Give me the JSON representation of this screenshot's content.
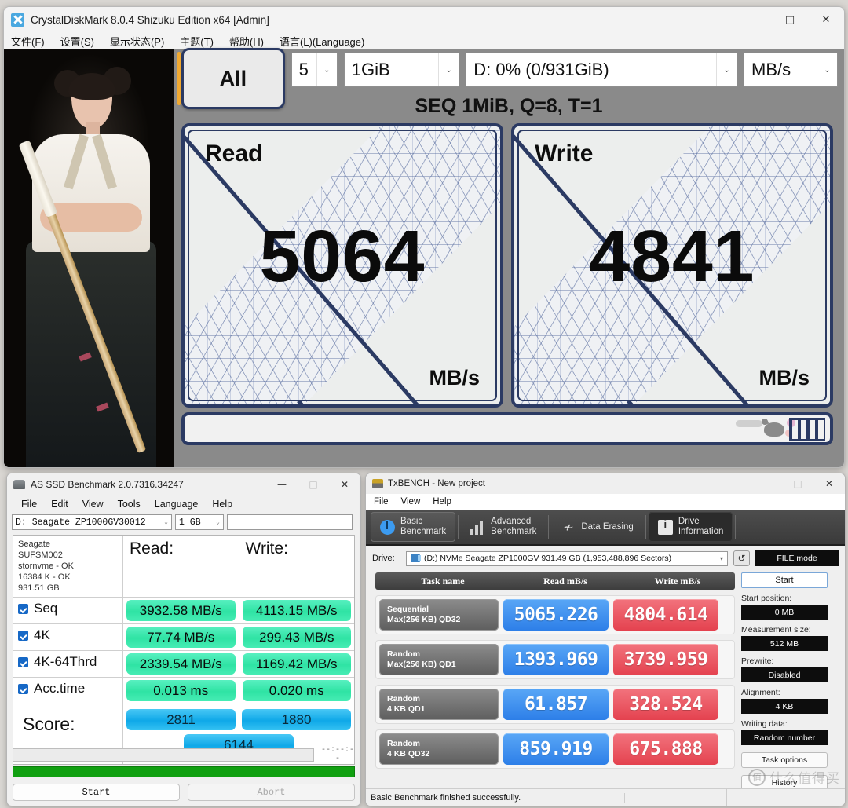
{
  "crystaldiskmark": {
    "title": "CrystalDiskMark 8.0.4 Shizuku Edition x64 [Admin]",
    "icon": "crystal-icon",
    "window_controls": {
      "minimize": "—",
      "maximize": "□",
      "close": "✕"
    },
    "menu": [
      "文件(F)",
      "设置(S)",
      "显示状态(P)",
      "主题(T)",
      "帮助(H)",
      "语言(L)(Language)"
    ],
    "toolbar": {
      "all_button": "All",
      "count": "5",
      "size": "1GiB",
      "drive": "D: 0% (0/931GiB)",
      "unit": "MB/s",
      "dropdown_arrow": "⌄"
    },
    "profile": "SEQ 1MiB, Q=8, T=1",
    "panels": [
      {
        "label": "Read",
        "value": "5064",
        "unit": "MB/s"
      },
      {
        "label": "Write",
        "value": "4841",
        "unit": "MB/s"
      }
    ]
  },
  "assd": {
    "title": "AS SSD Benchmark 2.0.7316.34247",
    "window_controls": {
      "minimize": "—",
      "maximize": "□",
      "close": "✕"
    },
    "menu": [
      "File",
      "Edit",
      "View",
      "Tools",
      "Language",
      "Help"
    ],
    "drive_select": "D: Seagate ZP1000GV30012",
    "size_select": "1 GB",
    "text_field": "",
    "dropdown_arrow": "⌄",
    "drive_info": {
      "vendor": "Seagate",
      "firmware": "SUFSM002",
      "driver": "stornvme - OK",
      "alignment": "16384 K - OK",
      "capacity": "931.51 GB"
    },
    "headers": {
      "read": "Read:",
      "write": "Write:"
    },
    "rows": [
      {
        "name": "Seq",
        "checked": true,
        "read": "3932.58 MB/s",
        "write": "4113.15 MB/s"
      },
      {
        "name": "4K",
        "checked": true,
        "read": "77.74 MB/s",
        "write": "299.43 MB/s"
      },
      {
        "name": "4K-64Thrd",
        "checked": true,
        "read": "2339.54 MB/s",
        "write": "1169.42 MB/s"
      },
      {
        "name": "Acc.time",
        "checked": true,
        "read": "0.013 ms",
        "write": "0.020 ms"
      }
    ],
    "score": {
      "label": "Score:",
      "read": "2811",
      "write": "1880",
      "total": "6144"
    },
    "status_text": "",
    "elapsed": "--:--:--",
    "progress_percent": 100,
    "buttons": {
      "start": "Start",
      "abort": "Abort"
    }
  },
  "txbench": {
    "title": "TxBENCH - New project",
    "window_controls": {
      "minimize": "—",
      "maximize": "□",
      "close": "✕"
    },
    "menu": [
      "File",
      "View",
      "Help"
    ],
    "tabs": [
      {
        "label_top": "Basic",
        "label_bottom": "Benchmark",
        "icon": "gauge-icon",
        "selected": true
      },
      {
        "label_top": "Advanced",
        "label_bottom": "Benchmark",
        "icon": "bars-icon",
        "selected": false
      },
      {
        "label_top": "Data Erasing",
        "label_bottom": "",
        "icon": "erase-icon",
        "selected": false
      },
      {
        "label_top": "Drive",
        "label_bottom": "Information",
        "icon": "drive-icon",
        "selected": false
      }
    ],
    "drive_label": "Drive:",
    "drive_value": "(D:) NVMe Seagate ZP1000GV  931.49 GB (1,953,488,896 Sectors)",
    "refresh_icon": "refresh-icon",
    "file_mode": "FILE mode",
    "table_headers": {
      "task": "Task name",
      "read": "Read mB/s",
      "write": "Write mB/s"
    },
    "tasks": [
      {
        "name_top": "Sequential",
        "name_bottom": "Max(256 KB) QD32",
        "read": "5065.226",
        "write": "4804.614"
      },
      {
        "name_top": "Random",
        "name_bottom": "Max(256 KB) QD1",
        "read": "1393.969",
        "write": "3739.959"
      },
      {
        "name_top": "Random",
        "name_bottom": "4 KB QD1",
        "read": "61.857",
        "write": "328.524"
      },
      {
        "name_top": "Random",
        "name_bottom": "4 KB QD32",
        "read": "859.919",
        "write": "675.888"
      }
    ],
    "sidebar": {
      "start": "Start",
      "options": [
        {
          "label": "Start position:",
          "value": "0 MB"
        },
        {
          "label": "Measurement size:",
          "value": "512 MB"
        },
        {
          "label": "Prewrite:",
          "value": "Disabled"
        },
        {
          "label": "Alignment:",
          "value": "4 KB"
        },
        {
          "label": "Writing data:",
          "value": "Random number"
        }
      ],
      "task_options": "Task options",
      "history": "History"
    },
    "status": "Basic Benchmark finished successfully."
  },
  "watermark": {
    "mark": "值",
    "text": "什么值得买"
  },
  "colors": {
    "cdm_border": "#2b3a63",
    "cdm_accent": "#f0a830",
    "assd_green": "#2fe3a4",
    "assd_blue": "#0fa8e8",
    "tx_read": "#2d7fe8",
    "tx_write": "#e4424f",
    "progress_green": "#11a011"
  }
}
